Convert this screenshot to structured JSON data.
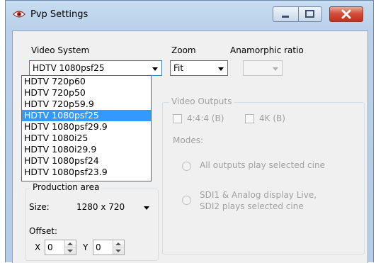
{
  "window": {
    "title": "Pvp Settings",
    "accent_color": "#3399ff",
    "close_color": "#c7402a",
    "icons": {
      "app": "pvp-eye-icon",
      "minimize": "minimize-icon",
      "maximize": "maximize-icon",
      "close": "close-icon"
    }
  },
  "video_system": {
    "label": "Video System",
    "selected": "HDTV 1080psf25",
    "options": [
      "HDTV 720p60",
      "HDTV 720p50",
      "HDTV 720p59.9",
      "HDTV 1080psf25",
      "HDTV 1080psf29.9",
      "HDTV 1080i25",
      "HDTV 1080i29.9",
      "HDTV 1080psf24",
      "HDTV 1080psf23.9"
    ],
    "selected_index": 3
  },
  "zoom": {
    "label": "Zoom",
    "selected": "Fit"
  },
  "anamorphic": {
    "label": "Anamorphic ratio",
    "selected": ""
  },
  "video_outputs": {
    "title": "Video Outputs",
    "checkbox_444": "4:4:4 (B)",
    "checkbox_4k": "4K (B)",
    "modes_label": "Modes:",
    "mode_all": "All outputs play selected cine",
    "mode_sdi_line1": "SDI1 & Analog display Live,",
    "mode_sdi_line2": "SDI2 plays selected cine"
  },
  "production_area": {
    "title": "Production area",
    "size_label": "Size:",
    "size_value": "1280 x 720",
    "offset_label": "Offset:",
    "x_label": "X",
    "x_value": "0",
    "y_label": "Y",
    "y_value": "0"
  }
}
